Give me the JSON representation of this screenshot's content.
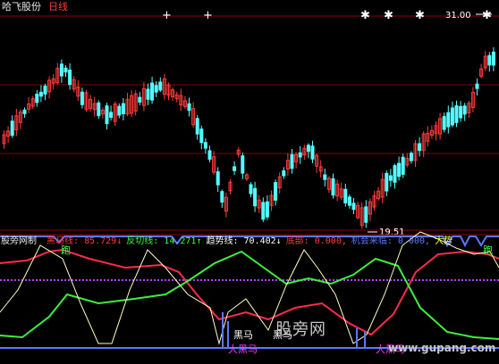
{
  "header": {
    "stock_name": "哈飞股份",
    "period": "日线"
  },
  "main_chart": {
    "type": "candlestick",
    "price_high_label": "31.00",
    "price_low_label": "19.51",
    "colors": {
      "up": "#ff3c3c",
      "down": "#54ffff",
      "grid": "#8b0000",
      "mark": "#ffffff"
    }
  },
  "indicator": {
    "name": "股旁网制",
    "items": [
      {
        "label": "黑马线:",
        "value": "85.729",
        "arrow": "↓",
        "color": "#ff3c3c"
      },
      {
        "label": "反切线:",
        "value": "14.271",
        "arrow": "↑",
        "color": "#3cff3c"
      },
      {
        "label": "趋势线:",
        "value": "70.402",
        "arrow": "↓",
        "color": "#ffffff"
      },
      {
        "label": "底部:",
        "value": "0.000,",
        "arrow": "",
        "color": "#ff3c3c"
      },
      {
        "label": "机会来临:",
        "value": "0.000,",
        "arrow": "",
        "color": "#5a78ff"
      },
      {
        "label": "大势",
        "value": "",
        "arrow": "",
        "color": "#ffff40"
      }
    ],
    "annotations": {
      "run": "跑",
      "dark_horse": "黑马",
      "big_dark_horse": "大黑马"
    }
  },
  "watermark": {
    "cn": "股旁网",
    "url": "www.gupang.com"
  }
}
